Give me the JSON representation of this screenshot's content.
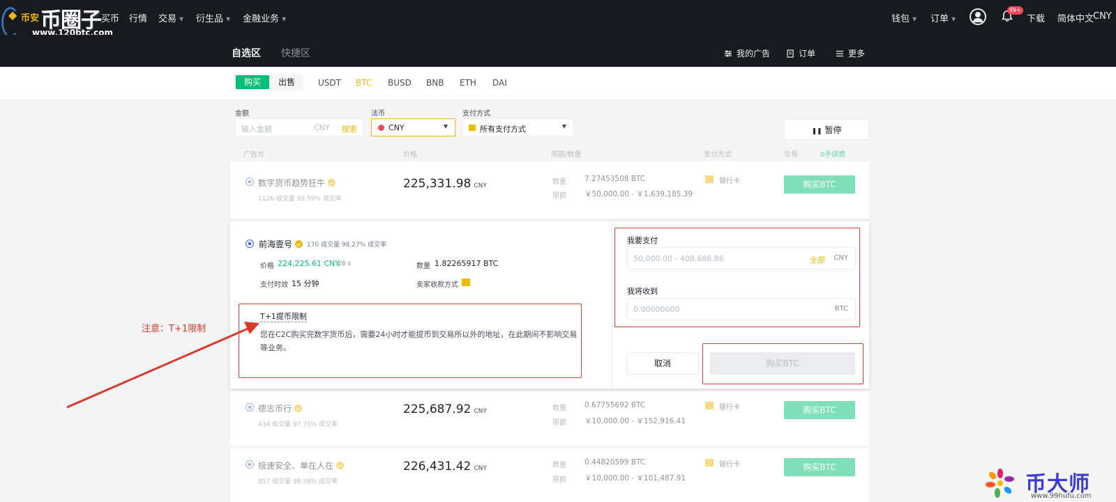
{
  "logo": {
    "small": "币安",
    "big": "币圈子",
    "url": "www.120btc.com"
  },
  "nav": {
    "items": [
      {
        "label": "买币",
        "has_caret": false
      },
      {
        "label": "行情",
        "has_caret": false
      },
      {
        "label": "交易",
        "has_caret": true
      },
      {
        "label": "衍生品",
        "has_caret": true
      },
      {
        "label": "金融业务",
        "has_caret": true
      }
    ],
    "wallet": "钱包",
    "orders": "订单",
    "badge": "99+",
    "download": "下载",
    "language": "简体中文",
    "currency": "CNY"
  },
  "subnav": {
    "tabs": [
      "自选区",
      "快捷区"
    ],
    "my_ads": "我的广告",
    "order": "订单",
    "more": "更多"
  },
  "assetbar": {
    "buy": "购买",
    "sell": "出售",
    "assets": [
      "USDT",
      "BTC",
      "BUSD",
      "BNB",
      "ETH",
      "DAI"
    ],
    "active_asset": "BTC"
  },
  "filters": {
    "amount_label": "金额",
    "amount_placeholder": "输入金额",
    "amount_currency": "CNY",
    "search": "搜索",
    "fiat_label": "法币",
    "fiat_value": "CNY",
    "payment_label": "支付方式",
    "payment_value": "所有支付方式",
    "pause": "暂停"
  },
  "table": {
    "headers": [
      "广告方",
      "价格",
      "限额/数量",
      "支付方式",
      "交易",
      "0手续费"
    ],
    "qty_label": "数量",
    "limit_label": "限额",
    "bank": "银行卡",
    "buy_btn": "购买BTC",
    "rows": [
      {
        "name": "数字货币趋势狂牛",
        "stats": "1126 成交量   95.59% 成交率",
        "price": "225,331.98",
        "cur": "CNY",
        "qty": "7.27453508 BTC",
        "limit": "￥50,000.00 - ￥1,639,185.39"
      },
      {
        "name": "德志币行",
        "stats": "434 成交量   97.75% 成交率",
        "price": "225,687.92",
        "cur": "CNY",
        "qty": "0.67755692 BTC",
        "limit": "￥10,000.00 - ￥152,916.41"
      },
      {
        "name": "极速安全、单在人在",
        "stats": "857 成交量   98.38% 成交率",
        "price": "226,431.42",
        "cur": "CNY",
        "qty": "0.44820599 BTC",
        "limit": "￥10,000.00 - ￥101,487.91"
      }
    ]
  },
  "expanded": {
    "name": "前海壹号",
    "stats": "170 成交量   98.27% 成交率",
    "price_label": "价格",
    "price": "224,225.61 CNY",
    "time": "28 s",
    "qty_label": "数量",
    "qty": "1.82265917 BTC",
    "pay_time_label": "支付时效",
    "pay_time": "15 分钟",
    "seller_pay_label": "卖家收款方式",
    "notice_title": "T+1提币限制",
    "notice_body": "您在C2C购买完数字货币后，需要24小时才能提币到交易所以外的地址，在此期间不影响交易等业务。",
    "pay_label": "我要支付",
    "pay_placeholder": "50,000.00 - 408,686.86",
    "all": "全部",
    "pay_currency": "CNY",
    "receive_label": "我将收到",
    "receive_placeholder": "0.00000000",
    "receive_currency": "BTC",
    "cancel": "取消",
    "confirm": "购买BTC"
  },
  "annotation": {
    "text": "注意：T+1限制"
  },
  "watermark": {
    "text": "币大师",
    "url": "www.99hufu.com"
  },
  "colors": {
    "brand": "#f0b90b",
    "buy_green": "#02c076",
    "annotation_red": "#d8392b",
    "nav_bg": "#181a20"
  }
}
